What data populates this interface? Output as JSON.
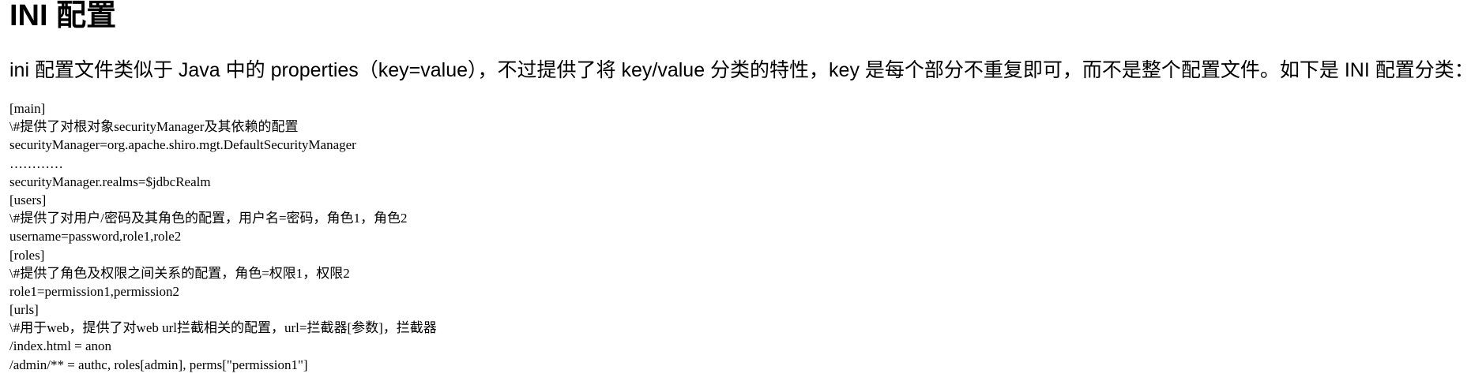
{
  "document": {
    "title": "INI 配置",
    "intro": "ini 配置文件类似于 Java 中的 properties（key=value），不过提供了将 key/value 分类的特性，key 是每个部分不重复即可，而不是整个配置文件。如下是 INI 配置分类：",
    "code_lines": [
      "[main]",
      "\\#提供了对根对象securityManager及其依赖的配置",
      "securityManager=org.apache.shiro.mgt.DefaultSecurityManager",
      "…………",
      "securityManager.realms=$jdbcRealm",
      "[users]",
      "\\#提供了对用户/密码及其角色的配置，用户名=密码，角色1，角色2",
      "username=password,role1,role2",
      "[roles]",
      "\\#提供了角色及权限之间关系的配置，角色=权限1，权限2",
      "role1=permission1,permission2",
      "[urls]",
      "\\#用于web，提供了对web url拦截相关的配置，url=拦截器[参数]，拦截器",
      "/index.html = anon",
      "/admin/** = authc, roles[admin], perms[\"permission1\"]"
    ]
  }
}
